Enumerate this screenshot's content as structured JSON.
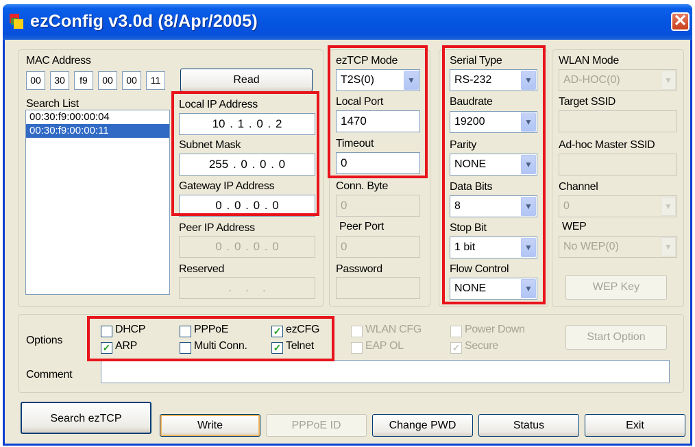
{
  "window": {
    "title": "ezConfig v3.0d (8/Apr/2005)",
    "close_glyph": "✕"
  },
  "mac": {
    "label": "MAC Address",
    "octets": [
      "00",
      "30",
      "f9",
      "00",
      "00",
      "11"
    ],
    "read_button": "Read"
  },
  "search_list": {
    "label": "Search List",
    "items": [
      "00:30:f9:00:00:04",
      "00:30:f9:00:00:11"
    ],
    "selected_index": 1
  },
  "network": {
    "local_ip_label": "Local IP Address",
    "local_ip": [
      "10",
      "1",
      "0",
      "2"
    ],
    "subnet_label": "Subnet Mask",
    "subnet": [
      "255",
      "0",
      "0",
      "0"
    ],
    "gateway_label": "Gateway IP Address",
    "gateway": [
      "0",
      "0",
      "0",
      "0"
    ],
    "peer_ip_label": "Peer IP Address",
    "peer_ip": [
      "0",
      "0",
      "0",
      "0"
    ],
    "reserved_label": "Reserved",
    "reserved": [
      ".",
      ".",
      "."
    ]
  },
  "eztcp": {
    "mode_label": "ezTCP Mode",
    "mode_value": "T2S(0)",
    "local_port_label": "Local Port",
    "local_port": "1470",
    "timeout_label": "Timeout",
    "timeout": "0",
    "conn_byte_label": "Conn. Byte",
    "conn_byte": "0",
    "peer_port_label": "Peer Port",
    "peer_port": "0",
    "password_label": "Password",
    "password": ""
  },
  "serial": {
    "type_label": "Serial Type",
    "type_value": "RS-232",
    "baudrate_label": "Baudrate",
    "baudrate_value": "19200",
    "parity_label": "Parity",
    "parity_value": "NONE",
    "data_bits_label": "Data Bits",
    "data_bits_value": "8",
    "stop_bit_label": "Stop Bit",
    "stop_bit_value": "1 bit",
    "flow_label": "Flow Control",
    "flow_value": "NONE"
  },
  "wlan": {
    "mode_label": "WLAN Mode",
    "mode_value": "AD-HOC(0)",
    "ssid_label": "Target SSID",
    "ssid": "",
    "adhoc_label": "Ad-hoc Master SSID",
    "adhoc": "",
    "channel_label": "Channel",
    "channel_value": "0",
    "wep_label": "WEP",
    "wep_value": "No WEP(0)",
    "wep_key_button": "WEP Key"
  },
  "options": {
    "label": "Options",
    "items": [
      {
        "label": "DHCP",
        "checked": false,
        "enabled": true
      },
      {
        "label": "PPPoE",
        "checked": false,
        "enabled": true
      },
      {
        "label": "ezCFG",
        "checked": true,
        "enabled": true
      },
      {
        "label": "ARP",
        "checked": true,
        "enabled": true
      },
      {
        "label": "Multi Conn.",
        "checked": false,
        "enabled": true
      },
      {
        "label": "Telnet",
        "checked": true,
        "enabled": true
      },
      {
        "label": "WLAN CFG",
        "checked": false,
        "enabled": false
      },
      {
        "label": "EAP OL",
        "checked": false,
        "enabled": false
      },
      {
        "label": "Power Down",
        "checked": false,
        "enabled": false
      },
      {
        "label": "Secure",
        "checked": true,
        "enabled": false
      }
    ],
    "start_option_button": "Start Option",
    "check_glyph": "✓"
  },
  "comment": {
    "label": "Comment",
    "value": ""
  },
  "buttons": {
    "search": "Search ezTCP",
    "write": "Write",
    "pppoe_id": "PPPoE ID",
    "change_pwd": "Change PWD",
    "status": "Status",
    "exit": "Exit"
  },
  "colors": {
    "highlight": "#e8141c",
    "selection": "#316ac5",
    "title_bar": "#0554e0"
  }
}
